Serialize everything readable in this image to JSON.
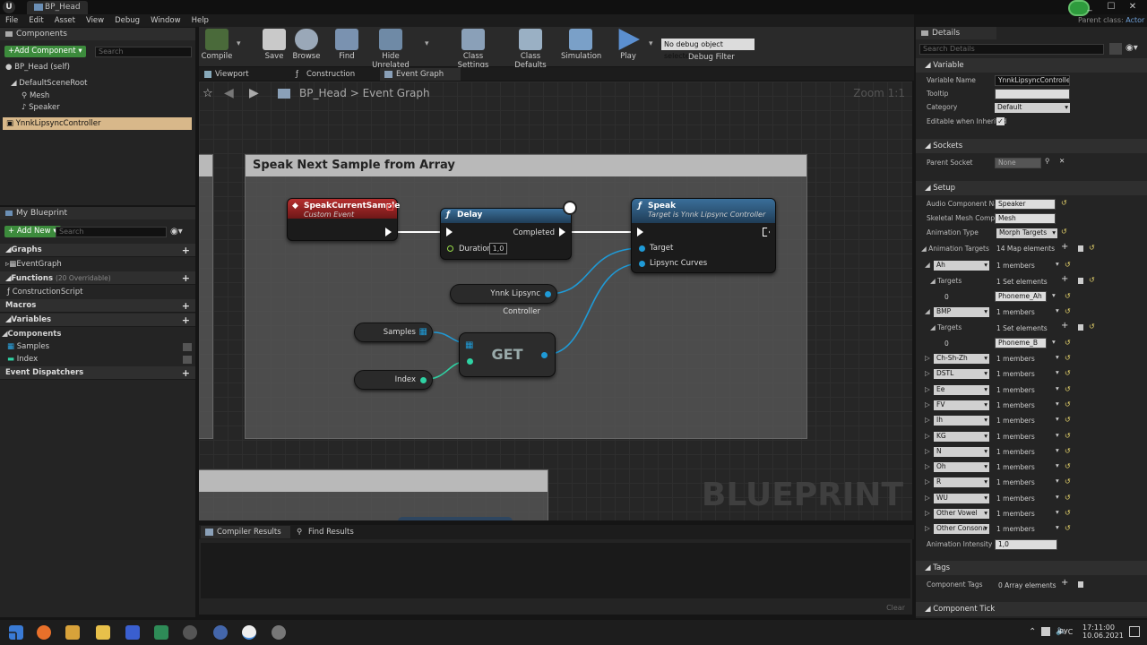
{
  "titlebar": {
    "tab": "BP_Head",
    "parent_class_label": "Parent class:",
    "parent_class": "Actor",
    "window_buttons": [
      "_",
      "☐",
      "✕"
    ]
  },
  "menu": [
    "File",
    "Edit",
    "Asset",
    "View",
    "Debug",
    "Window",
    "Help"
  ],
  "components": {
    "title": "Components",
    "add_button": "+Add Component ▾",
    "search_placeholder": "Search",
    "items": [
      "BP_Head (self)",
      "DefaultSceneRoot",
      "Mesh",
      "Speaker",
      "YnnkLipsyncController"
    ]
  },
  "my_blueprint": {
    "title": "My Blueprint",
    "add_button": "+ Add New ▾",
    "search_placeholder": "Search",
    "sections": {
      "graphs": "Graphs",
      "event_graph": "EventGraph",
      "functions": "Functions",
      "functions_note": "(20 Overridable)",
      "construction": "ConstructionScript",
      "macros": "Macros",
      "variables": "Variables",
      "components": "Components",
      "samples": "Samples",
      "index": "Index",
      "dispatchers": "Event Dispatchers"
    }
  },
  "toolbar": {
    "tools": [
      "Compile",
      "Save",
      "Browse",
      "Find",
      "Hide Unrelated",
      "Class Settings",
      "Class Defaults",
      "Simulation",
      "Play"
    ],
    "debug_select": "No debug object selected ▾",
    "debug_label": "Debug Filter"
  },
  "graph_tabs": [
    "Viewport",
    "Construction Scrip",
    "Event Graph"
  ],
  "graph": {
    "breadcrumb_root": "BP_Head",
    "breadcrumb_sep": ">",
    "breadcrumb_leaf": "Event Graph",
    "zoom": "Zoom 1:1",
    "watermark": "BLUEPRINT",
    "comment_title": "Speak Next Sample from Array",
    "event_node": {
      "title": "SpeakCurrentSample",
      "subtitle": "Custom Event"
    },
    "delay_node": {
      "title": "Delay",
      "completed": "Completed",
      "duration_label": "Duration",
      "duration_value": "1,0"
    },
    "speak_node": {
      "title": "Speak",
      "subtitle": "Target is Ynnk Lipsync Controller",
      "target": "Target",
      "curves": "Lipsync Curves"
    },
    "controller_var": "Ynnk Lipsync Controller",
    "samples_var": "Samples",
    "index_var": "Index",
    "get_node": "GET"
  },
  "bottom": {
    "tabs": [
      "Compiler Results",
      "Find Results"
    ],
    "clear": "Clear"
  },
  "details": {
    "title": "Details",
    "search_placeholder": "Search Details",
    "variable": {
      "header": "Variable",
      "name_label": "Variable Name",
      "name_value": "YnnkLipsyncController",
      "tooltip_label": "Tooltip",
      "category_label": "Category",
      "category_value": "Default",
      "editable_label": "Editable when Inherited"
    },
    "sockets": {
      "header": "Sockets",
      "parent_label": "Parent Socket",
      "parent_value": "None"
    },
    "setup": {
      "header": "Setup",
      "audio_label": "Audio Component Nam",
      "audio_value": "Speaker",
      "skeletal_label": "Skeletal Mesh Compo",
      "skeletal_value": "Mesh",
      "anim_type_label": "Animation Type",
      "anim_type_value": "Morph Targets",
      "targets_label": "Animation Targets",
      "targets_value": "14 Map elements",
      "map": [
        {
          "key": "Ah",
          "count": "1 members",
          "targets_label": "Targets",
          "targets_count": "1 Set elements",
          "index": "0",
          "phoneme": "Phoneme_Ah"
        },
        {
          "key": "BMP",
          "count": "1 members",
          "targets_label": "Targets",
          "targets_count": "1 Set elements",
          "index": "0",
          "phoneme": "Phoneme_B"
        }
      ],
      "collapsed": [
        {
          "key": "Ch-Sh-Zh",
          "count": "1 members"
        },
        {
          "key": "DSTL",
          "count": "1 members"
        },
        {
          "key": "Ee",
          "count": "1 members"
        },
        {
          "key": "FV",
          "count": "1 members"
        },
        {
          "key": "Ih",
          "count": "1 members"
        },
        {
          "key": "KG",
          "count": "1 members"
        },
        {
          "key": "N",
          "count": "1 members"
        },
        {
          "key": "Oh",
          "count": "1 members"
        },
        {
          "key": "R",
          "count": "1 members"
        },
        {
          "key": "WU",
          "count": "1 members"
        },
        {
          "key": "Other Vowel",
          "count": "1 members"
        },
        {
          "key": "Other Consona",
          "count": "1 members"
        }
      ],
      "intensity_label": "Animation Intensity",
      "intensity_value": "1,0"
    },
    "tags": {
      "header": "Tags",
      "label": "Component Tags",
      "value": "0 Array elements"
    },
    "tick": {
      "header": "Component Tick"
    }
  },
  "taskbar": {
    "lang": "РУС",
    "time": "17:11:00",
    "date": "10.06.2021"
  }
}
